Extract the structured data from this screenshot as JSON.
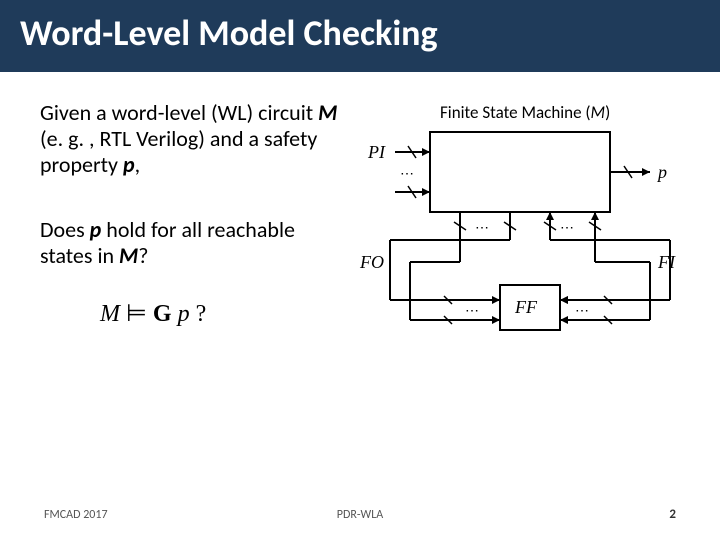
{
  "title": "Word-Level Model Checking",
  "para1_pre": "Given a word-level (WL) circuit ",
  "para1_M": "M",
  "para1_mid": " (e. g. , RTL Verilog) and a safety property ",
  "para1_p": "p",
  "para1_post": ",",
  "para2_pre": "Does ",
  "para2_p": "p",
  "para2_mid": " hold for all reachable states in ",
  "para2_M": "M",
  "para2_post": "?",
  "formula_M": "M",
  "formula_models": "⊨",
  "formula_G": "G",
  "formula_p": "p",
  "formula_q": "?",
  "diagram": {
    "title_pre": "Finite State Machine (",
    "title_M": "M",
    "title_post": ")",
    "PI": "PI",
    "p": "p",
    "FO": "FO",
    "FI": "FI",
    "FF": "FF",
    "dots": "⋯"
  },
  "footer": {
    "left": "FMCAD 2017",
    "center": "PDR-WLA",
    "page": "2"
  }
}
